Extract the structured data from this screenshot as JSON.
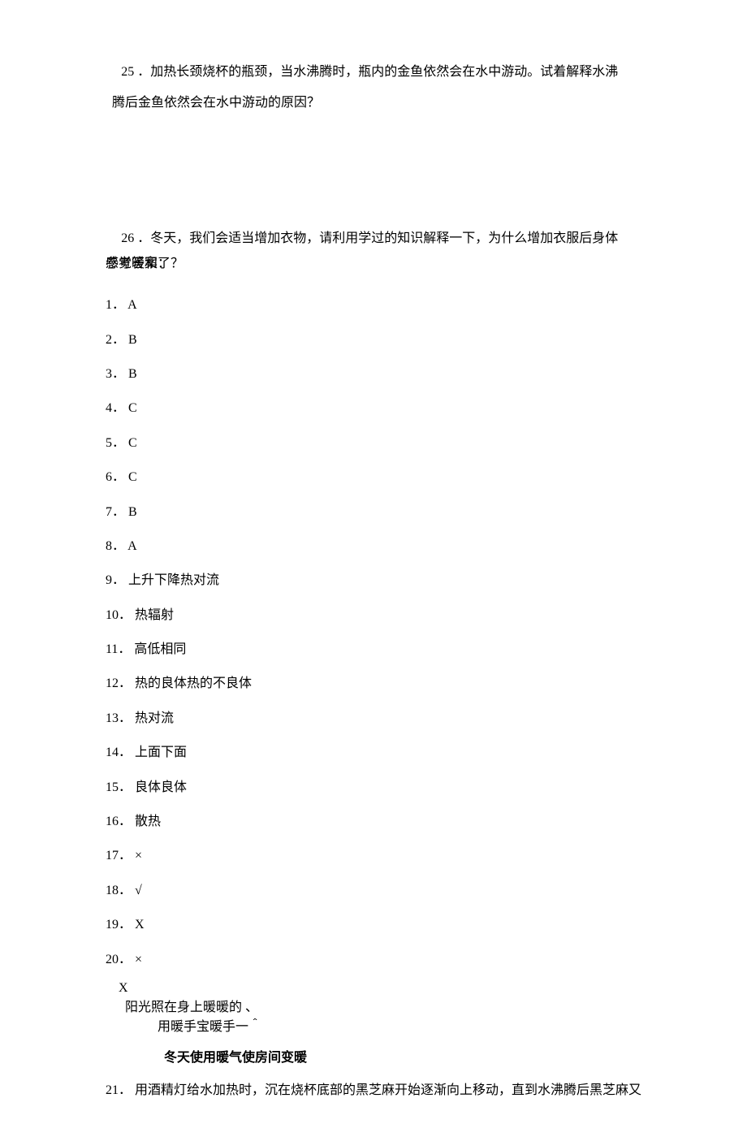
{
  "q25": {
    "line1": "25 ．加热长颈烧杯的瓶颈，当水沸腾时，瓶内的金鱼依然会在水中游动。试着解释水沸",
    "line2": "腾后金鱼依然会在水中游动的原因？"
  },
  "q26": {
    "line1": "26 ．冬天，我们会适当增加衣物，请利用学过的知识解释一下，为什么增加衣服后身体"
  },
  "overlap": {
    "a": "参考答案：",
    "b": "感觉暖和了？"
  },
  "answers": [
    "1． A",
    "2． B",
    "3． B",
    "4． C",
    "5． C",
    "6． C",
    "7． B",
    "8． A",
    "9． 上升下降热对流",
    "10． 热辐射",
    "11． 高低相同",
    "12． 热的良体热的不良体",
    "13． 热对流",
    "14． 上面下面",
    "15． 良体良体",
    "16． 散热",
    "17． ×",
    "18． √",
    "19． X",
    "20． ×"
  ],
  "block": {
    "l1": "X",
    "l2": "阳光照在身上暖暖的          、",
    "l3": "用暖手宝暖手一＾",
    "l4": "冬天使用暖气使房间变暖"
  },
  "final": "21． 用酒精灯给水加热时，沉在烧杯底部的黑芝麻开始逐渐向上移动，直到水沸腾后黑芝麻又"
}
